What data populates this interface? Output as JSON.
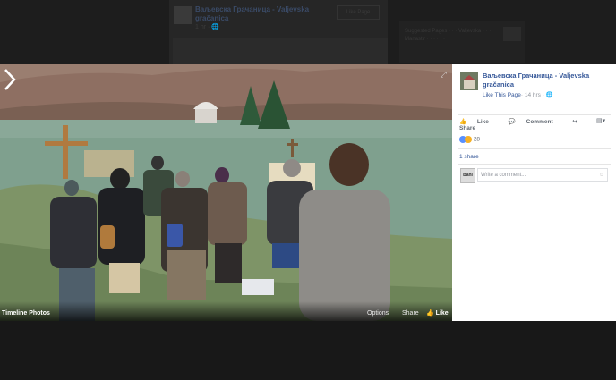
{
  "background": {
    "post_author": "Ваљевска Грачаница - Valjevska gračanica",
    "post_sub": "1 hr · 🌐",
    "like_page": "Like Page",
    "side_text": "Suggested Pages · · · Valjevska · · · Manastir · · · · · ·"
  },
  "photo": {
    "album_label": "Timeline Photos",
    "options_label": "Options",
    "share_label": "Share",
    "like_label": "Like"
  },
  "panel": {
    "page_name": "Ваљевска Грачаница - Valjevska gračanica",
    "like_this_page": "Like This Page",
    "time": "· 14 hrs · ",
    "actions": {
      "like": "Like",
      "comment": "Comment",
      "share": "Share"
    },
    "reaction_count": "28",
    "shares": "1 share",
    "comment_placeholder": "Write a comment...",
    "avatar_text": "Bani"
  },
  "colors": {
    "link": "#365899",
    "meta": "#90949c"
  }
}
